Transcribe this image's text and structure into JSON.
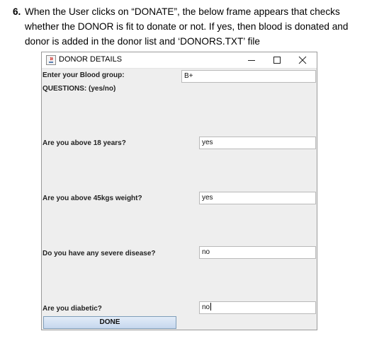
{
  "document": {
    "item_number": "6.",
    "lines": [
      "When the User clicks on “DONATE”, the below frame appears that checks",
      "whether the DONOR is fit to donate or not. If yes, then blood is donated and",
      "donor is added in the donor list and ‘DONORS.TXT’ file"
    ]
  },
  "window": {
    "title": "DONOR DETAILS",
    "controls": {
      "minimize": "—",
      "maximize": "☐",
      "close": "✕"
    }
  },
  "form": {
    "blood_group_label": "Enter your Blood group:",
    "blood_group_value": "B+",
    "questions_heading": "QUESTIONS: (yes/no)",
    "questions": [
      {
        "label": "Are you above 18 years?",
        "answer": "yes"
      },
      {
        "label": "Are you above 45kgs weight?",
        "answer": "yes"
      },
      {
        "label": "Do you have any severe disease?",
        "answer": "no"
      },
      {
        "label": "Are you diabetic?",
        "answer": "no"
      }
    ],
    "done_label": "DONE"
  }
}
